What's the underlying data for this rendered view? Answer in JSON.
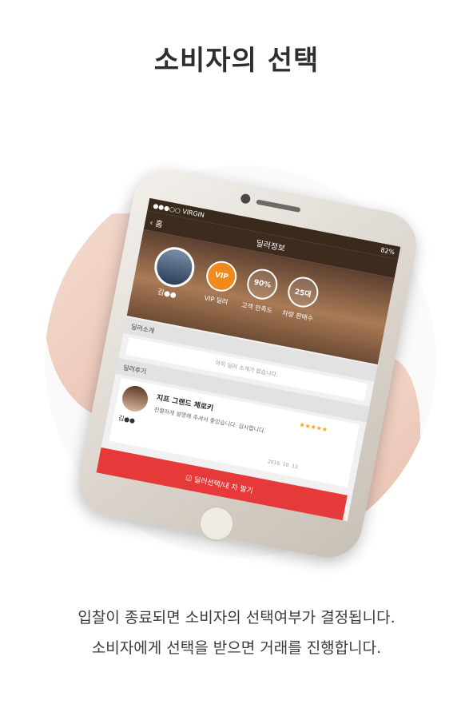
{
  "title": "소비자의 선택",
  "phone": {
    "status_bar": {
      "carrier": "●●●○○ VIRGIN",
      "battery": "82%"
    },
    "nav": {
      "back": "홈",
      "title": "딜러정보"
    },
    "dealer": {
      "name": "김●●",
      "badges": [
        {
          "value": "VIP",
          "label": "VIP 딜러"
        },
        {
          "value": "90%",
          "label": "고객 만족도"
        },
        {
          "value": "25대",
          "label": "차량 판매수"
        }
      ]
    },
    "intro": {
      "heading": "딜러소개",
      "text": "아직 딜러 소개가 없습니다."
    },
    "reviews": {
      "heading": "딜러후기",
      "items": [
        {
          "name": "김●●",
          "title": "지프 그랜드 체로키",
          "stars": "★★★★★",
          "text": "친절하게 설명해 주셔서 좋았습니다. 감사합니다.",
          "date": "2016. 10. 13"
        }
      ]
    },
    "cta": "☑ 딜러선택/내 차 팔기"
  },
  "captions": [
    "입찰이 종료되면 소비자의 선택여부가 결정됩니다.",
    "소비자에게 선택을 받으면 거래를 진행합니다."
  ]
}
